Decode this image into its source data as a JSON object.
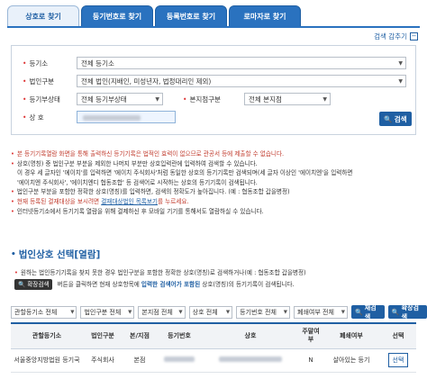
{
  "tabs": [
    {
      "label": "상호로 찾기",
      "active": true
    },
    {
      "label": "등기번호로 찾기",
      "active": false
    },
    {
      "label": "등록번호로 찾기",
      "active": false
    },
    {
      "label": "로마자로 찾기",
      "active": false
    }
  ],
  "search_toggle": {
    "label": "검색 감추기",
    "icon": "minus"
  },
  "form": {
    "registry_office": {
      "label": "등기소",
      "value": "전체 등기소"
    },
    "corp_type": {
      "label": "법인구분",
      "value": "전체 법인(지배인, 미성년자, 법정대리인 제외)"
    },
    "registry_status": {
      "label": "등기부상태",
      "value": "전체 등기부상태"
    },
    "branch_type": {
      "label": "본지점구분",
      "value": "전체 본지점"
    },
    "trade_name": {
      "label": "상 호",
      "value": ""
    },
    "search_button": "검색"
  },
  "notices": [
    {
      "text": "본 등기기록열람 화면을 통해 출력하신 등기기록은 법적인 효력이 없으므로 관공서 등에 제출할 수 없습니다.",
      "style": "red"
    },
    {
      "text": "상호(명칭) 중 법인구분 부분을 제외한 나머지 부분만 상호입력란에 입력하여 검색할 수 있습니다.",
      "style": "normal"
    },
    {
      "text": "이 경우 세 글자인 '에이치'를 입력하면 '에이치 주식회사'처럼 동일한 상호의 등기기록만 검색되며(세 글자 이상인 '에이치엔'을 입력하면",
      "style": "plain"
    },
    {
      "text": "'에이치엔 주식회사', '에이치엔디 협동조합' 등 검색어로 시작하는 상호의 등기기록이 검색됩니다.",
      "style": "plain"
    },
    {
      "text": "법인구분 부분을 포함한 정확한 상호(명칭)를 입력하면, 검색의 정확도가 높아집니다. (예 : 협동조합 갑을병정)",
      "style": "normal"
    },
    {
      "text_pre": "현재 등록된 결재대상을 보시려면 ",
      "link": "결재대상법인 목록보기",
      "text_post": "를 누르세요.",
      "style": "red-link"
    },
    {
      "text": "인터넷등기소에서 등기기록 열람을 위해 결제하신 후 모바일 기기를 통해서도 열람하실 수 있습니다.",
      "style": "normal"
    }
  ],
  "section": {
    "title": "법인상호 선택[열람]"
  },
  "info": {
    "line1": "원하는 법인등기기록을 찾지 못한 경우 법인구분을 포함한 정확한 상호(명칭)로 검색하거나(예 : 협동조합 갑을병정)",
    "expand_button": "확장검색",
    "line2_pre": " 버튼을 클릭하면 현재 상호항목에 ",
    "line2_bold": "입력한 검색어가 포함된",
    "line2_post": " 상호(명칭)의 등기기록이 검색됩니다."
  },
  "filters": {
    "office": "관할등기소 전체",
    "corp": "법인구분 전체",
    "branch": "본지점 전체",
    "name": "상호 전체",
    "registry_no": "등기번호 전체",
    "closed": "폐쇄여부 전체",
    "research_button": "재검색",
    "expand_button": "확장검색"
  },
  "table": {
    "headers": [
      "관할등기소",
      "법인구분",
      "본/지점",
      "등기번호",
      "상호",
      "주말여부",
      "폐쇄여부",
      "선택"
    ],
    "rows": [
      {
        "office": "서울중앙지방법원 등기국",
        "corp": "주식회사",
        "branch": "본점",
        "registry_no": "",
        "name": "",
        "weekend": "N",
        "closed": "살아있는 등기",
        "select": "선택"
      }
    ]
  }
}
